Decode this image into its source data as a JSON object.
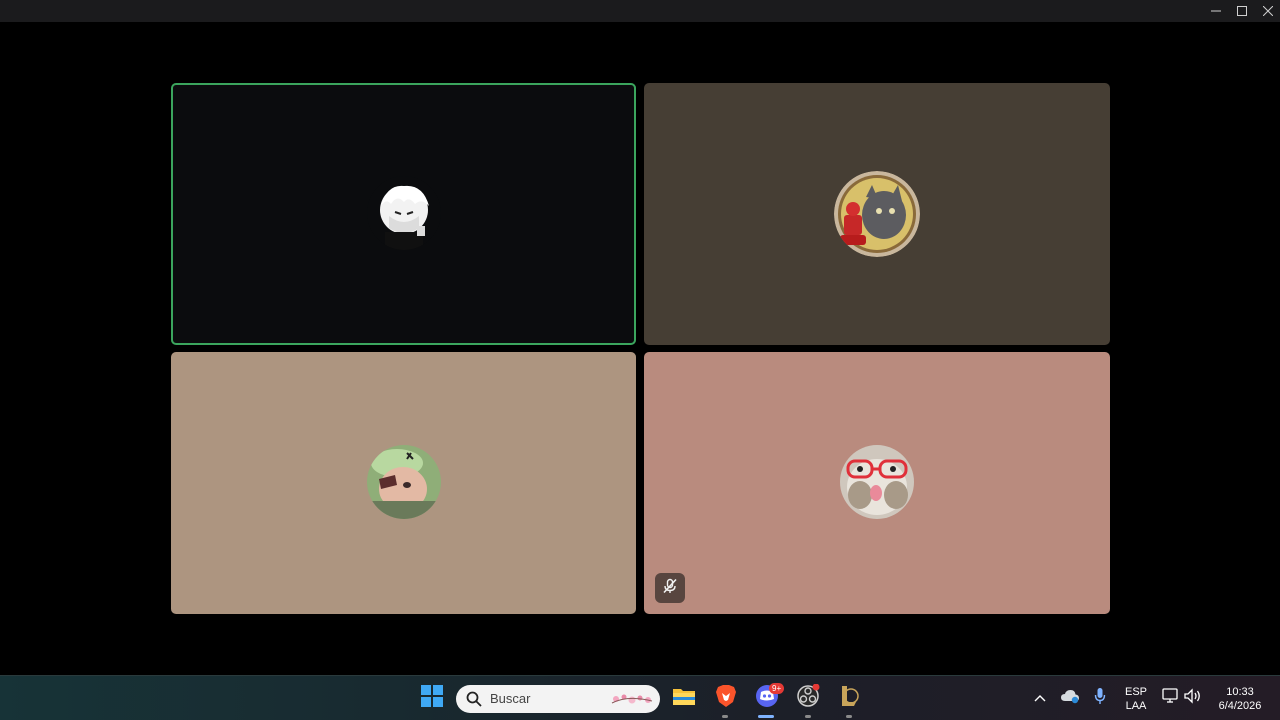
{
  "window": {
    "controls": [
      "minimize-icon",
      "maximize-icon",
      "close-icon"
    ]
  },
  "call": {
    "participants": [
      {
        "avatar": "white-haired-anime-avatar",
        "speaking": true,
        "muted": false,
        "tile_color": "#0b0c0e"
      },
      {
        "avatar": "cat-with-figure-avatar",
        "speaking": false,
        "muted": false,
        "tile_color": "#463e34"
      },
      {
        "avatar": "person-with-cap-avatar",
        "speaking": false,
        "muted": false,
        "tile_color": "#ad9580"
      },
      {
        "avatar": "cat-with-glasses-avatar",
        "speaking": false,
        "muted": true,
        "tile_color": "#b98b7e"
      }
    ]
  },
  "taskbar": {
    "search_placeholder": "Buscar",
    "apps": [
      "windows-start-icon",
      "file-explorer-icon",
      "brave-browser-icon",
      "discord-icon",
      "obs-icon",
      "league-client-icon"
    ],
    "discord_badge": "9+",
    "tray": {
      "language": "ESP",
      "layout": "LAA",
      "time": "10:33",
      "date": "6/4/2026"
    }
  }
}
